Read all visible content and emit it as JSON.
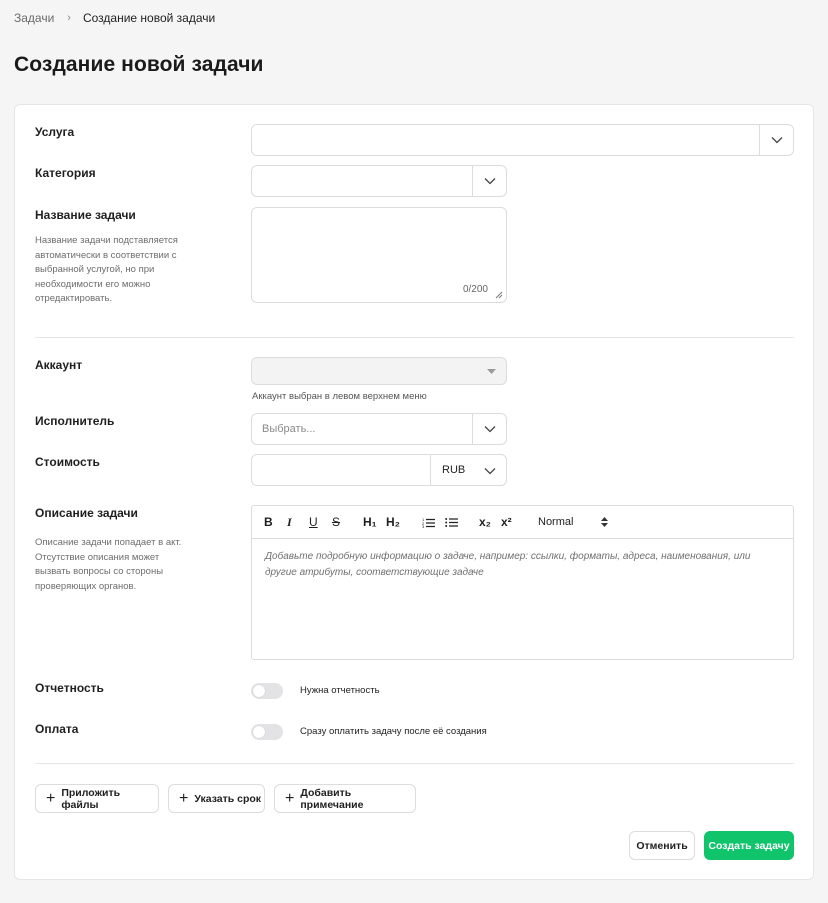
{
  "breadcrumb": {
    "parent": "Задачи",
    "separator": "›",
    "current": "Создание новой задачи"
  },
  "page": {
    "title": "Создание новой задачи"
  },
  "form": {
    "service": {
      "label": "Услуга",
      "value": ""
    },
    "category": {
      "label": "Категория",
      "value": ""
    },
    "task_name": {
      "label": "Название задачи",
      "hint": "Название задачи подставляется автоматически в соответствии с выбранной услугой, но при необходимости его можно отредактировать.",
      "counter": "0/200"
    },
    "account": {
      "label": "Аккаунт",
      "value": "",
      "hint": "Аккаунт выбран в левом верхнем меню"
    },
    "executor": {
      "label": "Исполнитель",
      "placeholder": "Выбрать..."
    },
    "cost": {
      "label": "Стоимость",
      "value": "",
      "currency": "RUB"
    },
    "description": {
      "label": "Описание задачи",
      "hint": "Описание задачи попадает в акт. Отсутствие описания может вызвать вопросы со стороны проверяющих органов.",
      "toolbar": {
        "bold": "B",
        "italic": "I",
        "underline": "U",
        "strike": "S",
        "h1": "H₁",
        "h2": "H₂",
        "subscript": "x₂",
        "superscript": "x²",
        "style": "Normal"
      },
      "placeholder": "Добавьте подробную информацию о задаче, например: ссылки, форматы, адреса, наименования, или другие атрибуты, соответствующие задаче"
    },
    "reporting": {
      "label": "Отчетность",
      "toggle_label": "Нужна отчетность",
      "enabled": false
    },
    "payment": {
      "label": "Оплата",
      "toggle_label": "Сразу оплатить задачу после её создания",
      "enabled": false
    }
  },
  "actions": {
    "attach": "Приложить файлы",
    "deadline": "Указать срок",
    "note": "Добавить примечание",
    "cancel": "Отменить",
    "create": "Создать задачу"
  },
  "colors": {
    "accent": "#10c46c",
    "border": "#dcdce0",
    "background": "#f5f5f6"
  },
  "icons": [
    "chevron-down-icon",
    "caret-down-icon",
    "resize-icon",
    "plus-icon",
    "ordered-list-icon",
    "bullet-list-icon",
    "updown-icon"
  ]
}
